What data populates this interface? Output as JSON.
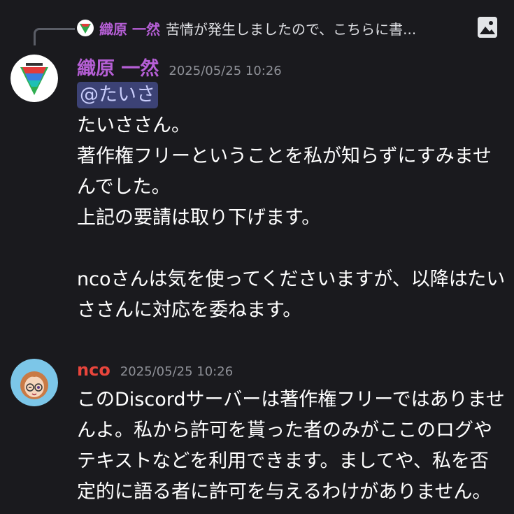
{
  "reply": {
    "author": "織原 一然",
    "snippet": "苦情が発生しましたので、こちらに書..."
  },
  "messages": [
    {
      "author": "織原 一然",
      "author_color": "#b65fd6",
      "timestamp": "2025/05/25 10:26",
      "mention": "@たいさ",
      "lines": [
        "たいささん。",
        "著作権フリーということを私が知らずにすみませ",
        "んでした。",
        "上記の要請は取り下げます。",
        "",
        "ncoさんは気を使ってくださいますが、以降はたい",
        "ささんに対応を委ねます。"
      ]
    },
    {
      "author": "nco",
      "author_color": "#e8453c",
      "timestamp": "2025/05/25 10:26",
      "lines": [
        "このDiscordサーバーは著作権フリーではありませ",
        "んよ。私から許可を貰った者のみがここのログや",
        "テキストなどを利用できます。ましてや、私を否",
        "定的に語る者に許可を与えるわけがありません。"
      ]
    }
  ]
}
